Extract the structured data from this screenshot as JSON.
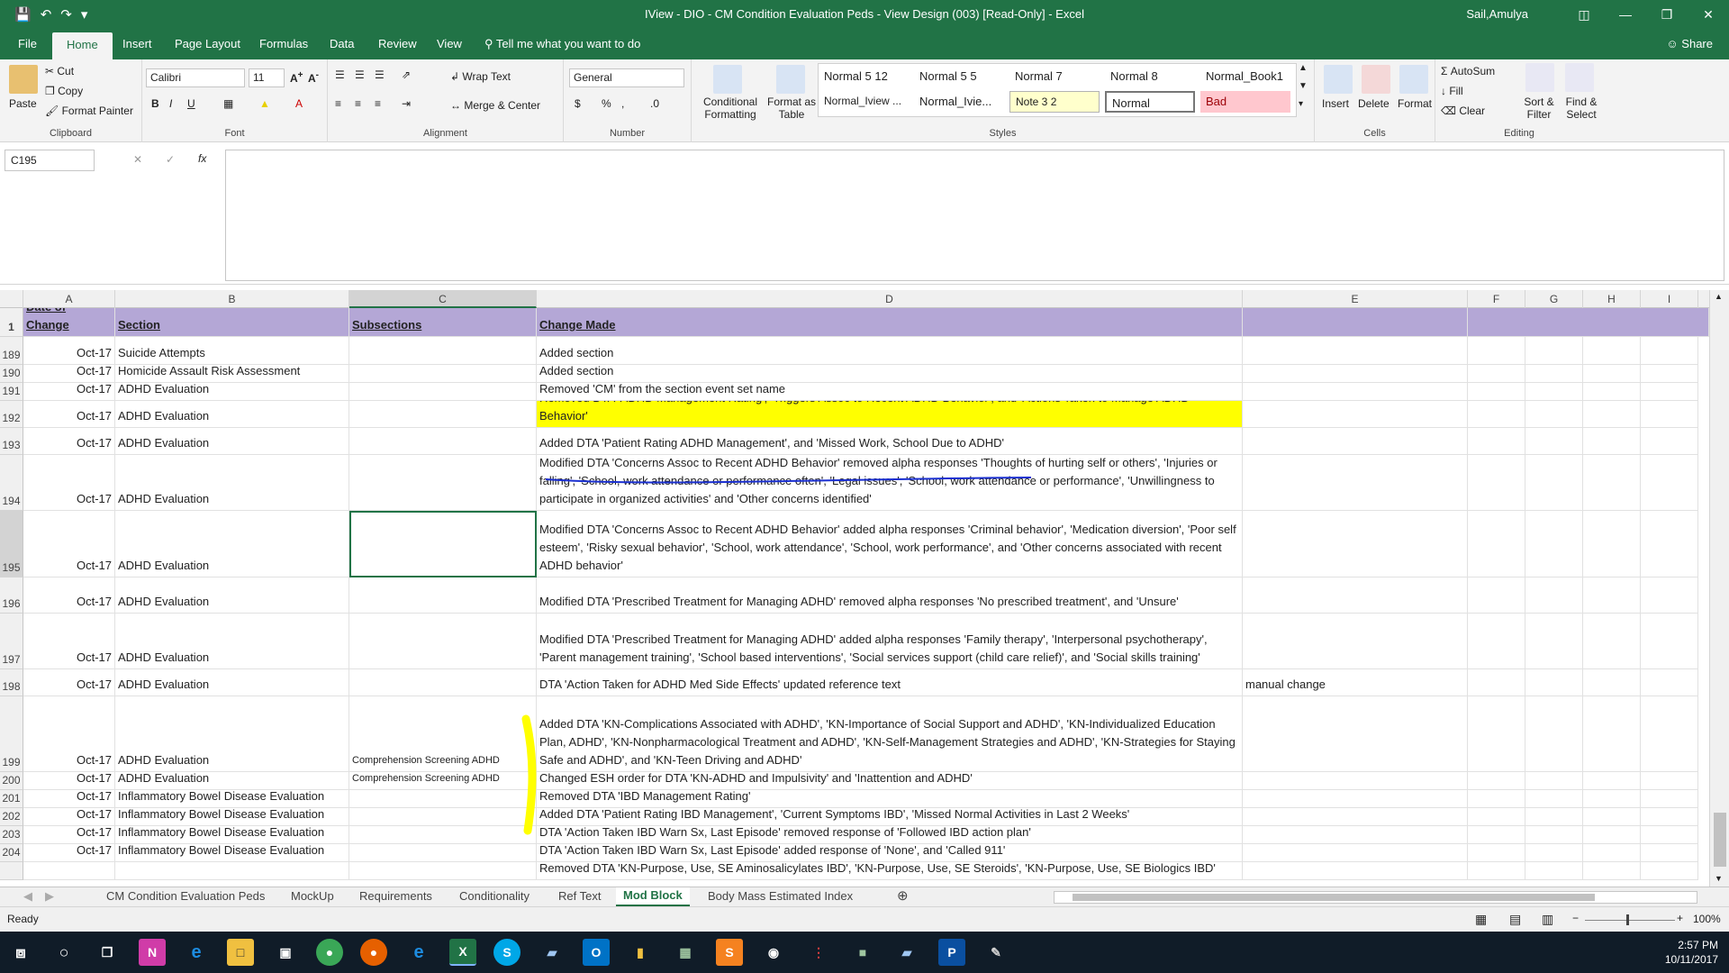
{
  "window": {
    "title": "IView - DIO - CM Condition Evaluation Peds - View Design (003)  [Read-Only]  -  Excel",
    "user": "Sail,Amulya"
  },
  "ribbon_tabs": [
    "File",
    "Home",
    "Insert",
    "Page Layout",
    "Formulas",
    "Data",
    "Review",
    "View"
  ],
  "tell_me": "Tell me what you want to do",
  "share": "Share",
  "clipboard": {
    "paste": "Paste",
    "cut": "Cut",
    "copy": "Copy",
    "format_painter": "Format Painter",
    "label": "Clipboard"
  },
  "font": {
    "name": "Calibri",
    "size": "11",
    "label": "Font"
  },
  "alignment": {
    "wrap": "Wrap Text",
    "merge": "Merge & Center",
    "label": "Alignment"
  },
  "number": {
    "format": "General",
    "label": "Number"
  },
  "styles": {
    "conditional": "Conditional Formatting",
    "format_table": "Format as Table",
    "cells": [
      "Normal 5 12",
      "Normal 5 5",
      "Normal 7",
      "Normal 8",
      "Normal_Book1",
      "Normal_Iview ...",
      "Normal_Ivie...",
      "Note 3 2",
      "Normal",
      "Bad"
    ],
    "label": "Styles"
  },
  "cells_group": {
    "insert": "Insert",
    "delete": "Delete",
    "format": "Format",
    "label": "Cells"
  },
  "editing": {
    "autosum": "AutoSum",
    "fill": "Fill",
    "clear": "Clear",
    "sort": "Sort & Filter",
    "find": "Find & Select",
    "label": "Editing"
  },
  "name_box": "C195",
  "fx": "fx",
  "columns": [
    "A",
    "B",
    "C",
    "D",
    "E",
    "F",
    "G",
    "H",
    "I"
  ],
  "header_row": {
    "num": "1",
    "a": "Date of Change",
    "b": "Section",
    "c": "Subsections",
    "d": "Change Made"
  },
  "rows": [
    {
      "num": "189",
      "a": "Oct-17",
      "b": "Suicide Attempts",
      "c": "",
      "d": "Added section",
      "e": ""
    },
    {
      "num": "190",
      "a": "Oct-17",
      "b": "Homicide Assault Risk Assessment",
      "c": "",
      "d": "Added section",
      "e": ""
    },
    {
      "num": "191",
      "a": "Oct-17",
      "b": "ADHD Evaluation",
      "c": "",
      "d": "Removed 'CM' from the section event set name",
      "e": ""
    },
    {
      "num": "192",
      "a": "Oct-17",
      "b": "ADHD Evaluation",
      "c": "",
      "d": "Removed DTA 'ADHD Management Rating', 'Triggers Assoc to Recent ADHD Behavior', and 'Actions Taken to Manage ADHD Behavior'",
      "e": ""
    },
    {
      "num": "193",
      "a": "Oct-17",
      "b": "ADHD Evaluation",
      "c": "",
      "d": "Added DTA 'Patient Rating ADHD Management', and 'Missed Work, School Due to ADHD'",
      "e": ""
    },
    {
      "num": "194",
      "a": "Oct-17",
      "b": "ADHD Evaluation",
      "c": "",
      "d": "Modified DTA 'Concerns Assoc to Recent ADHD Behavior' removed alpha responses 'Thoughts of hurting self or others', 'Injuries or falling', 'School, work attendance or performance often', 'Legal issues', 'School, work attendance or performance', 'Unwillingness to participate in organized activities' and 'Other concerns identified'",
      "e": ""
    },
    {
      "num": "195",
      "a": "Oct-17",
      "b": "ADHD Evaluation",
      "c": "",
      "d": "Modified DTA 'Concerns Assoc to Recent ADHD Behavior' added alpha responses 'Criminal behavior', 'Medication diversion', 'Poor self esteem', 'Risky sexual behavior', 'School, work attendance', 'School, work performance', and 'Other concerns associated with recent ADHD behavior'",
      "e": ""
    },
    {
      "num": "196",
      "a": "Oct-17",
      "b": "ADHD Evaluation",
      "c": "",
      "d": "Modified DTA 'Prescribed Treatment for Managing ADHD' removed alpha responses 'No prescribed treatment', and 'Unsure'",
      "e": ""
    },
    {
      "num": "197",
      "a": "Oct-17",
      "b": "ADHD Evaluation",
      "c": "",
      "d": "Modified DTA 'Prescribed Treatment for Managing ADHD' added alpha responses 'Family therapy', 'Interpersonal psychotherapy', 'Parent management training', 'School based interventions', 'Social services support (child care relief)', and 'Social skills training'",
      "e": ""
    },
    {
      "num": "198",
      "a": "Oct-17",
      "b": "ADHD Evaluation",
      "c": "",
      "d": "DTA 'Action Taken for ADHD Med Side Effects' updated reference text",
      "e": "manual change"
    },
    {
      "num": "199",
      "a": "Oct-17",
      "b": "ADHD Evaluation",
      "c": "Comprehension Screening ADHD",
      "d": "Added DTA 'KN-Complications Associated with ADHD', 'KN-Importance of Social Support and ADHD', 'KN-Individualized Education Plan, ADHD', 'KN-Nonpharmacological Treatment and ADHD', 'KN-Self-Management Strategies and ADHD', 'KN-Strategies for Staying Safe and ADHD', and 'KN-Teen Driving and ADHD'",
      "e": ""
    },
    {
      "num": "200",
      "a": "Oct-17",
      "b": "ADHD Evaluation",
      "c": "Comprehension Screening ADHD",
      "d": "Changed ESH order for DTA 'KN-ADHD and Impulsivity' and 'Inattention and ADHD'",
      "e": ""
    },
    {
      "num": "201",
      "a": "Oct-17",
      "b": "Inflammatory Bowel Disease Evaluation",
      "c": "",
      "d": "Removed DTA 'IBD Management Rating'",
      "e": ""
    },
    {
      "num": "202",
      "a": "Oct-17",
      "b": "Inflammatory Bowel Disease Evaluation",
      "c": "",
      "d": "Added DTA 'Patient Rating IBD Management', 'Current Symptoms IBD',  'Missed Normal Activities in Last 2 Weeks'",
      "e": ""
    },
    {
      "num": "203",
      "a": "Oct-17",
      "b": "Inflammatory Bowel Disease Evaluation",
      "c": "",
      "d": "DTA 'Action Taken IBD Warn Sx, Last Episode' removed response of 'Followed IBD action plan'",
      "e": ""
    },
    {
      "num": "204",
      "a": "Oct-17",
      "b": "Inflammatory Bowel Disease Evaluation",
      "c": "",
      "d": "DTA 'Action Taken IBD Warn Sx, Last Episode' added response of 'None', and 'Called 911'",
      "e": ""
    },
    {
      "num": "",
      "a": "",
      "b": "",
      "c": "",
      "d": "Removed DTA 'KN-Purpose, Use, SE Aminosalicylates IBD', 'KN-Purpose, Use, SE Steroids', 'KN-Purpose, Use, SE Biologics IBD'",
      "e": ""
    }
  ],
  "sheets": [
    "CM Condition Evaluation Peds",
    "MockUp",
    "Requirements",
    "Conditionality",
    "Ref Text",
    "Mod Block",
    "Body Mass Estimated Index"
  ],
  "active_sheet": "Mod Block",
  "status": "Ready",
  "zoom": "100%",
  "clock": {
    "time": "2:57 PM",
    "date": "10/11/2017"
  }
}
